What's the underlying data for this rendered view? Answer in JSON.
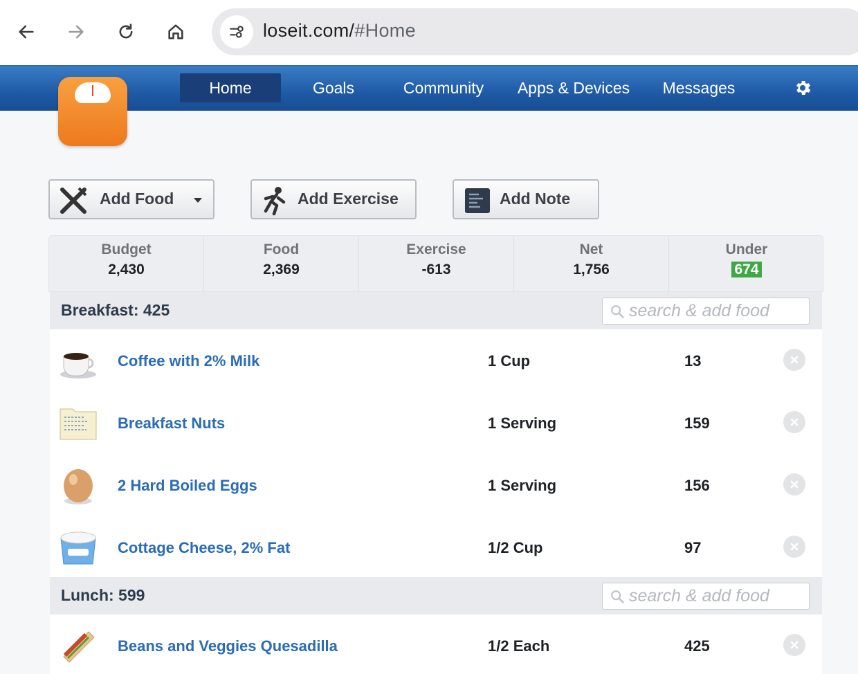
{
  "browser": {
    "url_host": "loseit.com/",
    "url_path": "#Home",
    "icons": [
      "back-arrow-icon",
      "forward-arrow-icon",
      "reload-icon",
      "home-icon",
      "site-info-icon"
    ]
  },
  "site": {
    "brand_color": "#1f5aa6",
    "nav": {
      "home": "Home",
      "goals": "Goals",
      "community": "Community",
      "apps": "Apps & Devices",
      "messages": "Messages"
    }
  },
  "actions": {
    "add_food": "Add Food",
    "add_exercise": "Add Exercise",
    "add_note": "Add Note"
  },
  "summary": {
    "budget_label": "Budget",
    "budget_value": "2,430",
    "food_label": "Food",
    "food_value": "2,369",
    "exercise_label": "Exercise",
    "exercise_value": "-613",
    "net_label": "Net",
    "net_value": "1,756",
    "under_label": "Under",
    "under_value": "674",
    "under_color": "#3fa844"
  },
  "meals": {
    "breakfast": {
      "title": "Breakfast: 425",
      "search_placeholder": "search & add food",
      "items": [
        {
          "name": "Coffee with 2% Milk",
          "qty": "1 Cup",
          "cal": "13",
          "icon": "coffee-cup-icon"
        },
        {
          "name": "Breakfast Nuts",
          "qty": "1 Serving",
          "cal": "159",
          "icon": "recipe-folder-icon"
        },
        {
          "name": "2 Hard Boiled Eggs",
          "qty": "1 Serving",
          "cal": "156",
          "icon": "egg-icon"
        },
        {
          "name": "Cottage Cheese, 2% Fat",
          "qty": "1/2 Cup",
          "cal": "97",
          "icon": "cottage-cheese-tub-icon"
        }
      ]
    },
    "lunch": {
      "title": "Lunch: 599",
      "search_placeholder": "search & add food",
      "items": [
        {
          "name": "Beans and Veggies Quesadilla",
          "qty": "1/2 Each",
          "cal": "425",
          "icon": "burrito-icon"
        }
      ]
    }
  }
}
